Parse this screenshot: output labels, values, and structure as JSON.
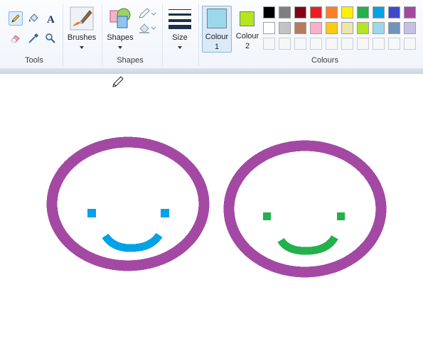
{
  "groups": {
    "tools_label": "Tools",
    "brushes_label": "Brushes",
    "shapes_label": "Shapes",
    "shapes_group_label": "Shapes",
    "size_label": "Size",
    "colour1_label_line1": "Colour",
    "colour1_label_line2": "1",
    "colour2_label_line1": "Colour",
    "colour2_label_line2": "2",
    "colours_group_label": "Colours"
  },
  "colours": {
    "colour1": "#99d9ea",
    "colour2": "#b5e61d",
    "palette_row1": [
      "#000000",
      "#7f7f7f",
      "#880015",
      "#ed1c24",
      "#ff7f27",
      "#fff200",
      "#22b14c",
      "#00a2e8",
      "#3f48cc",
      "#a349a4"
    ],
    "palette_row2": [
      "#ffffff",
      "#c3c3c3",
      "#b97a57",
      "#ffaec9",
      "#ffc90e",
      "#efe4b0",
      "#b5e61d",
      "#99d9ea",
      "#7092be",
      "#c8bfe7"
    ],
    "palette_row3_empty_count": 10
  },
  "canvas": {
    "smiley1_outline": "#a349a4",
    "smiley1_face": "#00a2e8",
    "smiley2_outline": "#a349a4",
    "smiley2_face": "#22b14c"
  },
  "tool_icons": [
    "pencil-icon",
    "fill-icon",
    "text-icon",
    "eraser-icon",
    "color-picker-icon",
    "magnifier-icon"
  ]
}
